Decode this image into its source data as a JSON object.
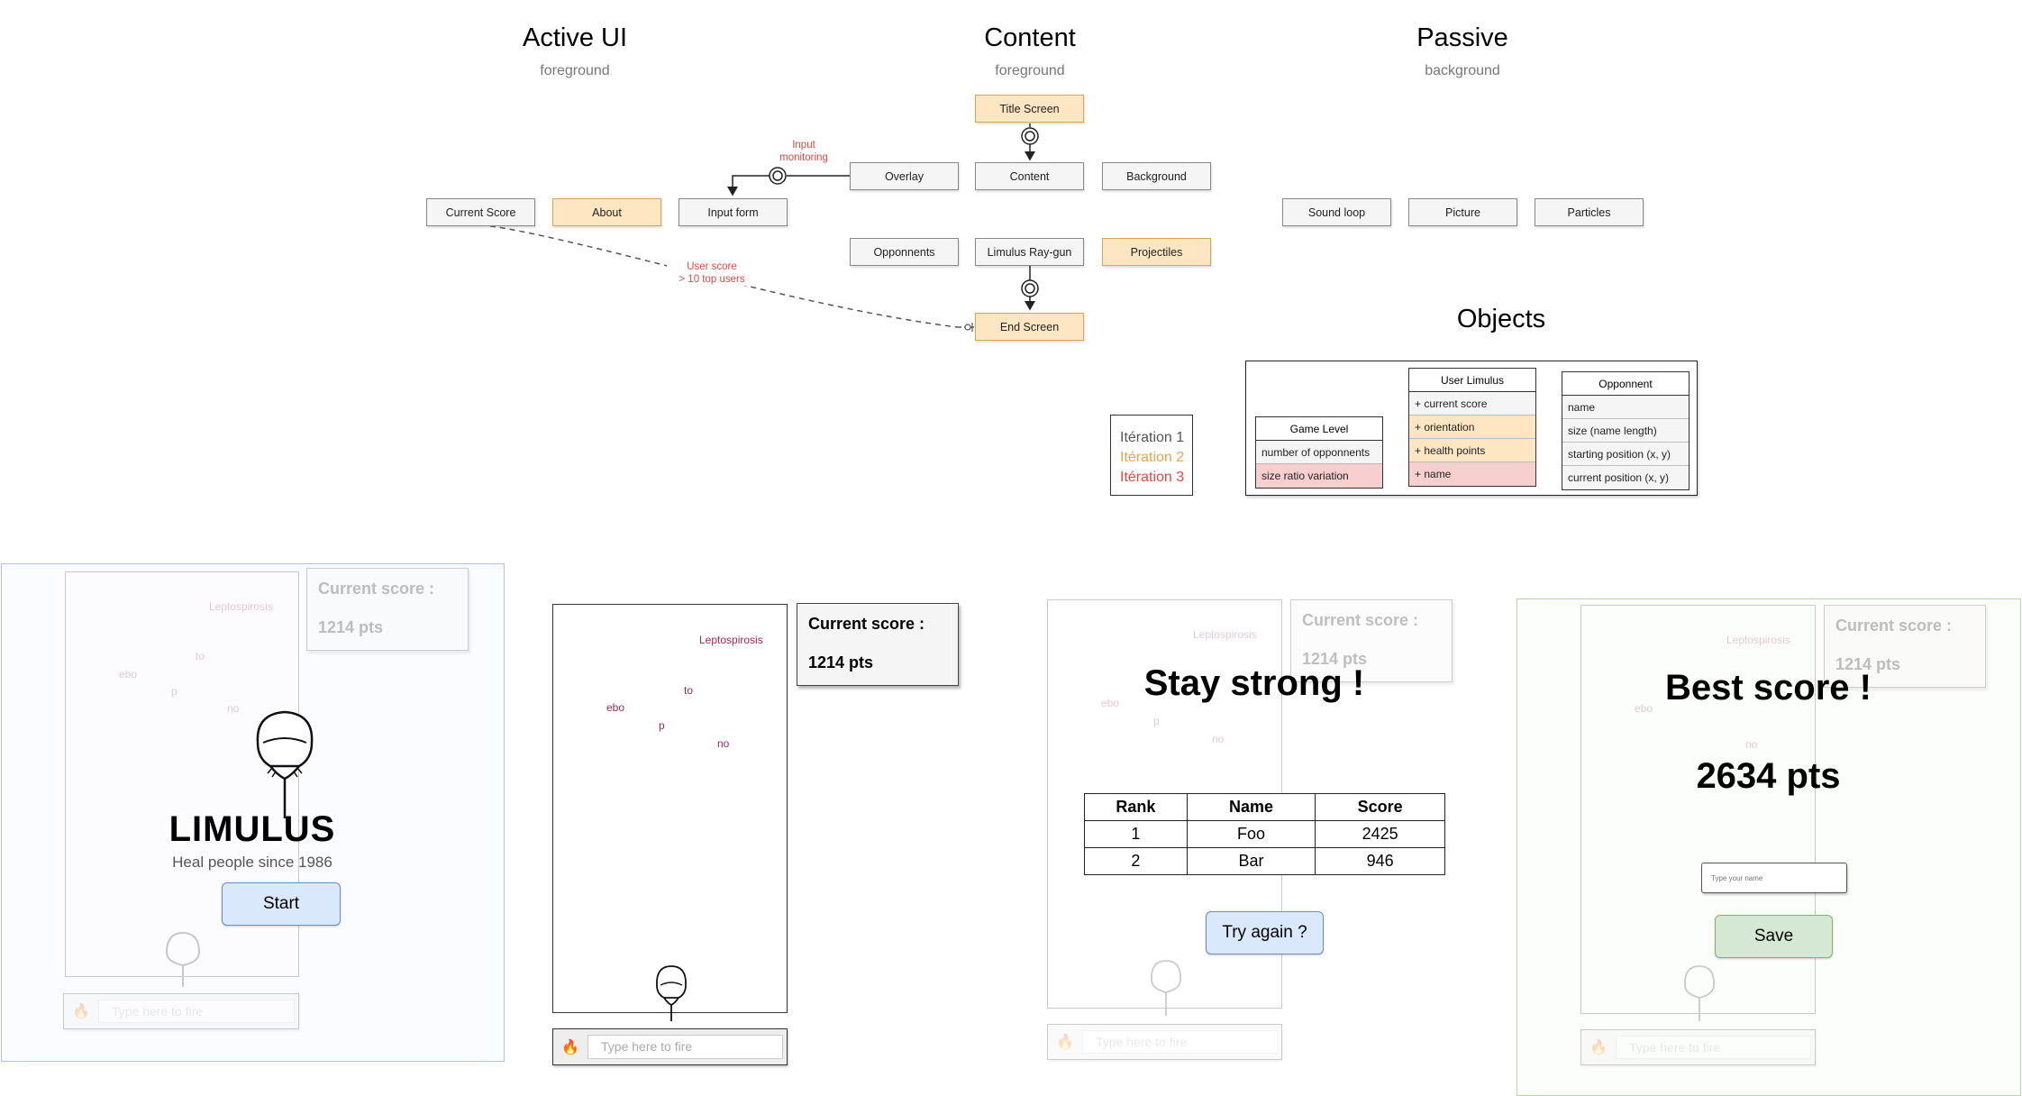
{
  "columns": {
    "active": {
      "title": "Active UI",
      "subtitle": "foreground"
    },
    "content": {
      "title": "Content",
      "subtitle": "foreground"
    },
    "passive": {
      "title": "Passive",
      "subtitle": "background"
    }
  },
  "nodes": {
    "title_screen": "Title Screen",
    "overlay": "Overlay",
    "content": "Content",
    "background": "Background",
    "current_score": "Current Score",
    "about": "About",
    "input_form": "Input form",
    "opponents": "Opponnents",
    "raygun": "Limulus Ray-gun",
    "projectiles": "Projectiles",
    "end_screen": "End Screen",
    "sound_loop": "Sound loop",
    "picture": "Picture",
    "particles": "Particles"
  },
  "edge_labels": {
    "input_monitoring": [
      "Input",
      "monitoring"
    ],
    "user_score": [
      "User score",
      "> 10 top users"
    ]
  },
  "legend": {
    "items": [
      {
        "label": "Itération 1",
        "color": "#555555"
      },
      {
        "label": "Itération 2",
        "color": "#f0a04b"
      },
      {
        "label": "Itération 3",
        "color": "#e0483e"
      }
    ]
  },
  "objects": {
    "title": "Objects",
    "game_level": {
      "header": "Game Level",
      "rows": [
        "number of opponnents",
        "size ratio variation"
      ]
    },
    "user_limulus": {
      "header": "User Limulus",
      "rows": [
        "+ current score",
        "+ orientation",
        "+ health points",
        "+ name"
      ]
    },
    "opponent": {
      "header": "Opponnent",
      "rows": [
        "name",
        "size (name length)",
        "starting position (x, y)",
        "current position (x, y)"
      ]
    }
  },
  "screens": {
    "words": [
      "Leptospirosis",
      "to",
      "ebo",
      "p",
      "no"
    ],
    "score_label": "Current score :",
    "score_value": "1214 pts",
    "input_placeholder": "Type here to fire",
    "title_screen": {
      "logo": "LIMULUS",
      "tagline": "Heal people since 1986",
      "start": "Start"
    },
    "end_screen": {
      "heading": "Stay strong !",
      "table": {
        "headers": [
          "Rank",
          "Name",
          "Score"
        ],
        "rows": [
          [
            "1",
            "Foo",
            "2425"
          ],
          [
            "2",
            "Bar",
            "946"
          ]
        ]
      },
      "retry": "Try again ?"
    },
    "best_screen": {
      "heading": "Best score !",
      "score": "2634 pts",
      "name_placeholder": "Type your name",
      "save": "Save"
    }
  },
  "colors": {
    "orange": "#ffe6c2",
    "red_label": "#e0483e",
    "word": "#a2265a",
    "blue_button": "#dae8fc",
    "green_button": "#d5e8d4"
  }
}
